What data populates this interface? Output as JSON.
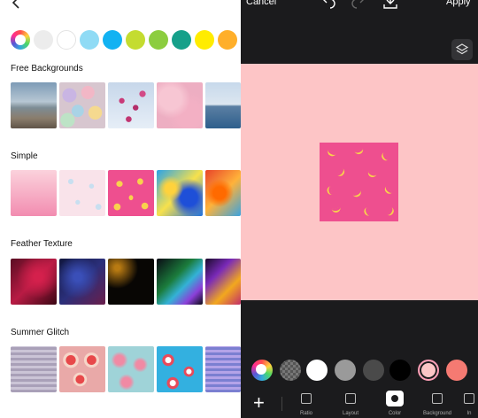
{
  "left_panel": {
    "back_icon": "chevron-left-icon",
    "color_swatches": [
      "rainbow",
      "#ececec",
      "#ffffff",
      "#8fdbf5",
      "#12b2f2",
      "#c4dc30",
      "#8ccd3f",
      "#16a08a",
      "#ffec00",
      "#ffaf2a"
    ],
    "sections": [
      {
        "title": "Free Backgrounds",
        "thumbs": [
          "beach",
          "easter-eggs",
          "pink-blossom",
          "pink-clouds",
          "sea-horizon"
        ]
      },
      {
        "title": "Simple",
        "thumbs": [
          "pink-gradient",
          "hearts-pattern",
          "banana-pattern",
          "paint-splash",
          "orange-splash"
        ]
      },
      {
        "title": "Feather Texture",
        "thumbs": [
          "red-feathers",
          "navy-feathers",
          "dark-gold",
          "rainbow-feathers",
          "purple-feathers"
        ]
      },
      {
        "title": "Summer Glitch",
        "thumbs": [
          "palm-glitch",
          "donut-glitch",
          "donut-pattern",
          "pool-floats",
          "blue-palms"
        ]
      }
    ]
  },
  "right_panel": {
    "cancel_label": "Cancel",
    "apply_label": "Apply",
    "canvas_color": "#fdc5c6",
    "pattern_color": "#ee4f8f",
    "color_options": [
      "rainbow",
      "transparent",
      "#ffffff",
      "#9a9a9a",
      "#4a4a4a",
      "#000000",
      "#fdc5c6",
      "#f57a72"
    ],
    "toolbar": [
      {
        "label": "Ratio",
        "icon": "ratio-icon"
      },
      {
        "label": "Layout",
        "icon": "layout-icon"
      },
      {
        "label": "Color",
        "icon": "color-icon",
        "active": true
      },
      {
        "label": "Background",
        "icon": "background-icon"
      },
      {
        "label": "In",
        "icon": "more-icon"
      }
    ]
  }
}
